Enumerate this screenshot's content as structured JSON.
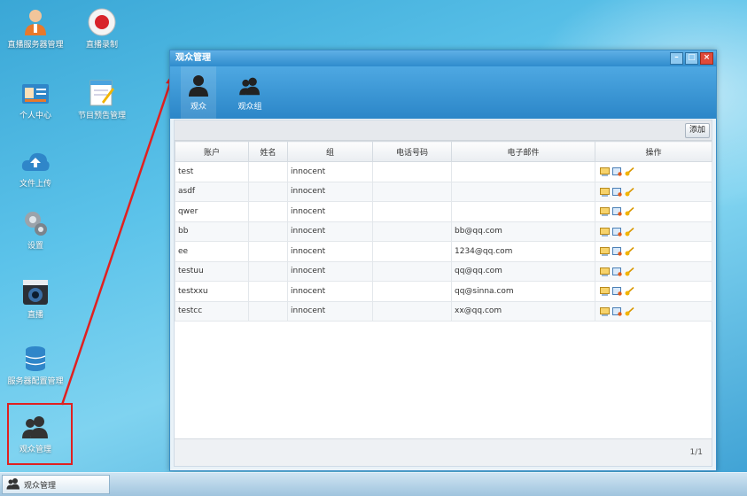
{
  "desktop": {
    "icons": [
      {
        "name": "avatar-user-icon",
        "label": "直播服务器管理"
      },
      {
        "name": "record-icon",
        "label": "直播录制"
      },
      {
        "name": "id-card-icon",
        "label": "个人中心"
      },
      {
        "name": "notepad-icon",
        "label": "节目预告管理"
      },
      {
        "name": "cloud-upload-icon",
        "label": "文件上传"
      },
      {
        "name": "settings-icon",
        "label": "设置"
      },
      {
        "name": "camera-icon",
        "label": "直播"
      },
      {
        "name": "database-icon",
        "label": "服务器配置管理"
      },
      {
        "name": "users-icon",
        "label": "观众管理"
      }
    ]
  },
  "window": {
    "title": "观众管理",
    "controls": {
      "minimize": "–",
      "maximize": "□",
      "close": "×"
    },
    "toolbar": [
      {
        "label": "观众",
        "icon": "user-icon"
      },
      {
        "label": "观众组",
        "icon": "users-icon"
      }
    ],
    "add_label": "添加",
    "table": {
      "columns": [
        "账户",
        "姓名",
        "组",
        "电话号码",
        "电子邮件",
        "操作"
      ],
      "rows": [
        {
          "account": "test",
          "name": "",
          "group": "innocent",
          "phone": "",
          "email": ""
        },
        {
          "account": "asdf",
          "name": "",
          "group": "innocent",
          "phone": "",
          "email": ""
        },
        {
          "account": "qwer",
          "name": "",
          "group": "innocent",
          "phone": "",
          "email": ""
        },
        {
          "account": "bb",
          "name": "",
          "group": "innocent",
          "phone": "",
          "email": "bb@qq.com"
        },
        {
          "account": "ee",
          "name": "",
          "group": "innocent",
          "phone": "",
          "email": "1234@qq.com"
        },
        {
          "account": "testuu",
          "name": "",
          "group": "innocent",
          "phone": "",
          "email": "qq@qq.com"
        },
        {
          "account": "testxxu",
          "name": "",
          "group": "innocent",
          "phone": "",
          "email": "qq@sinna.com"
        },
        {
          "account": "testcc",
          "name": "",
          "group": "innocent",
          "phone": "",
          "email": "xx@qq.com"
        }
      ],
      "row_actions": [
        "edit-icon",
        "details-icon",
        "key-icon"
      ]
    },
    "pagination": "1/1"
  },
  "taskbar": {
    "task_label": "观众管理"
  },
  "colors": {
    "accent": "#2f8ccd",
    "annotation": "#e02020"
  }
}
